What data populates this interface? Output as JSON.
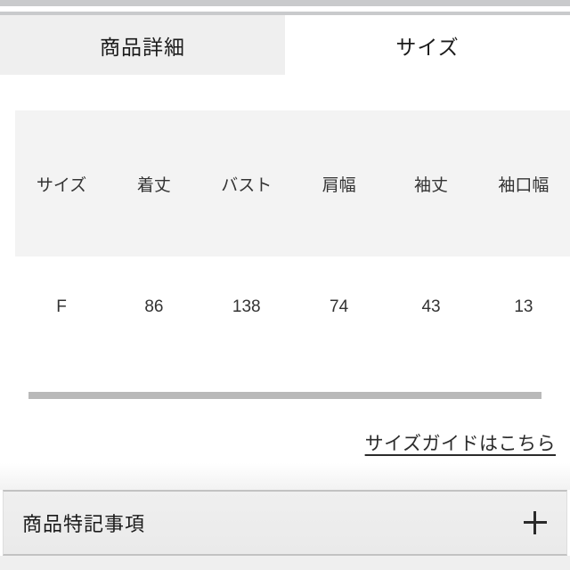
{
  "window": {
    "background": "#ffffff",
    "accent": "#2b2b2b"
  },
  "tabs": {
    "items": [
      {
        "label": "商品詳細",
        "active": false,
        "background": "#efefef"
      },
      {
        "label": "サイズ",
        "active": true,
        "background": "#ffffff"
      }
    ]
  },
  "size_table": {
    "headers": [
      "サイズ",
      "着丈",
      "バスト",
      "肩幅",
      "袖丈",
      "袖口幅"
    ],
    "rows": [
      [
        "F",
        "86",
        "138",
        "74",
        "43",
        "13"
      ]
    ],
    "header_background": "#f3f3f3",
    "scrollable": true
  },
  "scrollbar": {
    "orientation": "horizontal",
    "thumb_color": "#b9b9b9"
  },
  "size_guide": {
    "link_label": "サイズガイドはこちら"
  },
  "accordion": {
    "title": "商品特記事項",
    "expand_icon": "plus-icon",
    "expanded": false
  }
}
